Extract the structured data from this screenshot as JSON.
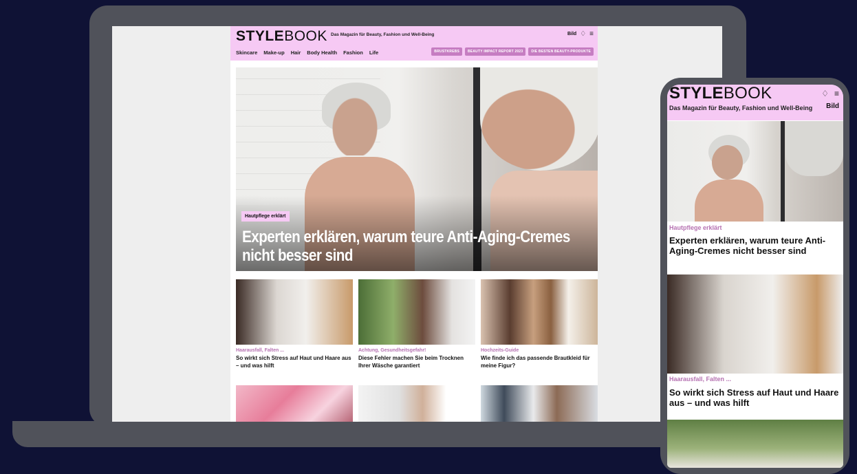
{
  "brand": {
    "logo_bold": "STYLE",
    "logo_light": "BOOK",
    "tagline": "Das Magazin für Beauty, Fashion und Well-Being",
    "partner": "Bild"
  },
  "nav": [
    "Skincare",
    "Make-up",
    "Hair",
    "Body Health",
    "Fashion",
    "Life"
  ],
  "pills": [
    "BRUSTKREBS",
    "BEAUTY IMPACT REPORT 2023",
    "DIE BESTEN BEAUTY-PRODUKTE"
  ],
  "hero": {
    "kicker": "Hautpflege erklärt",
    "title": "Experten erklären, warum teure Anti-Aging-Cremes nicht besser sind"
  },
  "cards": [
    {
      "kicker": "Haarausfall, Falten ...",
      "title": "So wirkt sich Stress auf Haut und Haare aus – und was hilft"
    },
    {
      "kicker": "Achtung, Gesundheitsgefahr!",
      "title": "Diese Fehler machen Sie beim Trocknen Ihrer Wäsche garantiert"
    },
    {
      "kicker": "Hochzeits-Guide",
      "title": "Wie finde ich das passende Brautkleid für meine Figur?"
    }
  ],
  "icons": {
    "bell": "bell-icon",
    "menu": "menu-icon"
  },
  "colors": {
    "accent_pink": "#f6c9f4",
    "kicker_purple": "#b672b2",
    "pill_purple": "#c67dc2",
    "background": "#0f1235",
    "device": "#50525a"
  }
}
